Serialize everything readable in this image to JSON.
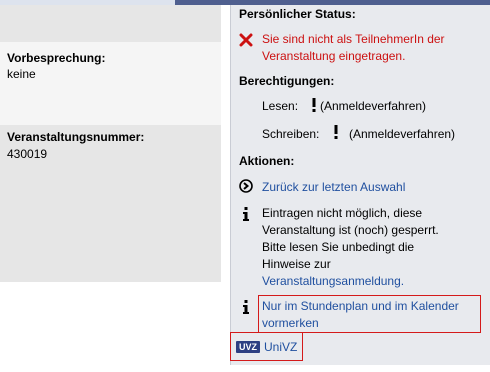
{
  "left": {
    "vorbesprechung_label": "Vorbesprechung:",
    "vorbesprechung_value": "keine",
    "veranstaltungsnummer_label": "Veranstaltungsnummer:",
    "veranstaltungsnummer_value": "430019"
  },
  "right": {
    "status_heading": "Persönlicher Status:",
    "status_line1": "Sie sind nicht als TeilnehmerIn der",
    "status_line2": "Veranstaltung eingetragen.",
    "berechtigungen_heading": "Berechtigungen:",
    "lesen_label": "Lesen:",
    "lesen_value": "(Anmeldeverfahren)",
    "schreiben_label": "Schreiben:",
    "schreiben_value": "(Anmeldeverfahren)",
    "aktionen_heading": "Aktionen:",
    "zurueck_link": "Zurück zur letzten Auswahl",
    "info_line1": "Eintragen nicht möglich, diese",
    "info_line2": "Veranstaltung ist (noch) gesperrt.",
    "info_line3": "Bitte lesen Sie unbedingt die",
    "info_line4": "Hinweise zur",
    "info_link": "Veranstaltungsanmeldung.",
    "stundenplan_line1": "Nur im Stundenplan und im Kalender",
    "stundenplan_line2": "vormerken",
    "univz_badge": "UVZ",
    "univz_link": "UniVZ"
  },
  "colors": {
    "link": "#1f4f9f",
    "error": "#cc1111",
    "highlight": "#d41a1a",
    "panel": "#e8eaee",
    "badge": "#2d3f82"
  }
}
